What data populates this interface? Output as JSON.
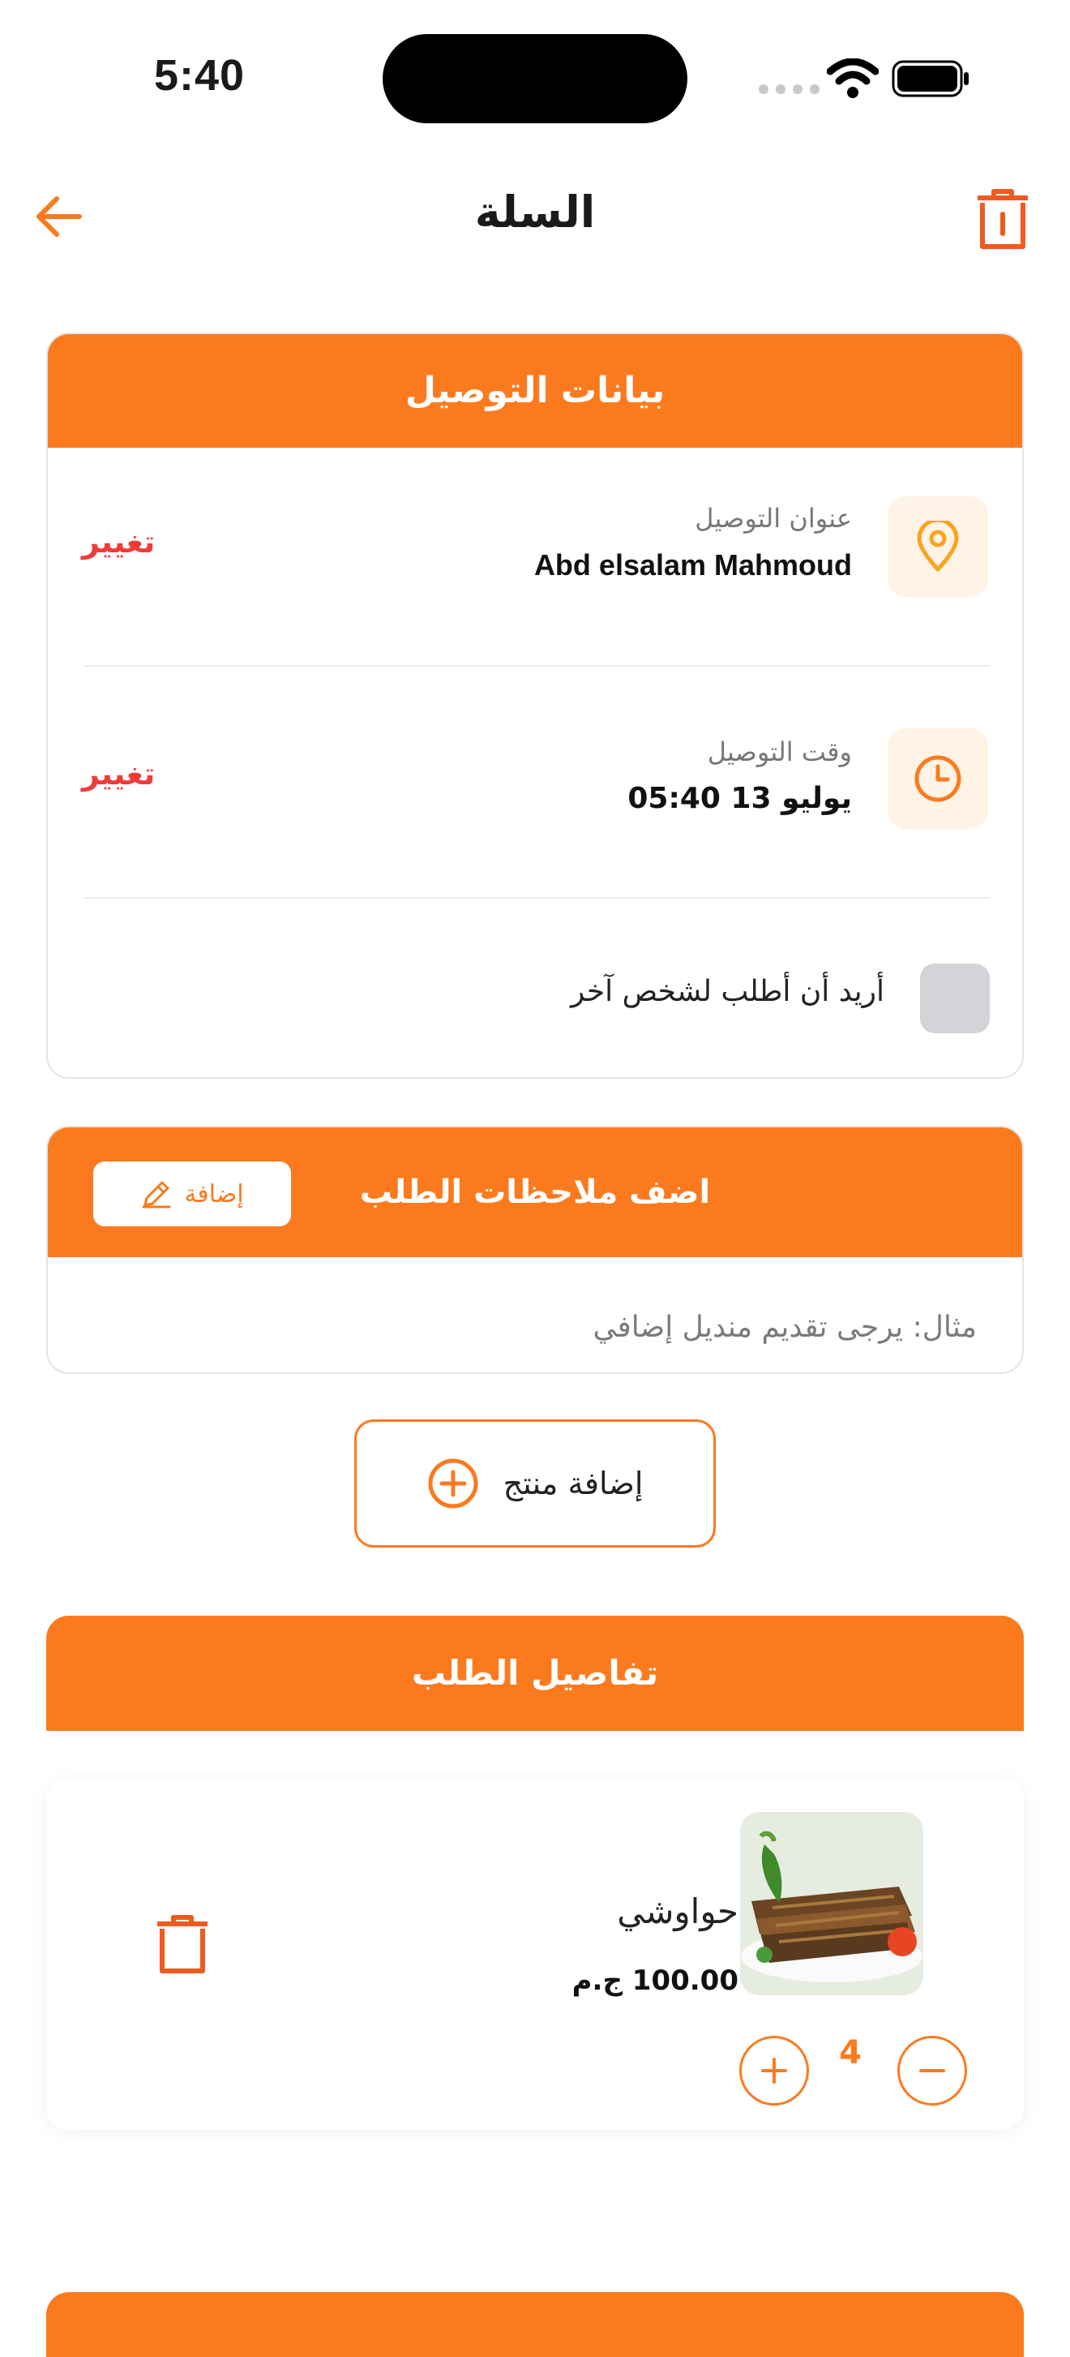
{
  "status_bar": {
    "time": "5:40"
  },
  "header": {
    "title": "السلة"
  },
  "delivery_card": {
    "title": "بيانات التوصيل",
    "address": {
      "label": "عنوان التوصيل",
      "value": "Abd elsalam Mahmoud",
      "change": "تغيير"
    },
    "time": {
      "label": "وقت التوصيل",
      "value": "يوليو 13  05:40",
      "change": "تغيير"
    },
    "other_person_label": "أريد أن أطلب لشخص آخر"
  },
  "notes_card": {
    "title": "اضف ملاحظات الطلب",
    "add_button": "إضافة",
    "placeholder": "مثال: يرجى تقديم منديل إضافي"
  },
  "add_product_label": "إضافة منتج",
  "order_details": {
    "title": "تفاصيل الطلب",
    "items": [
      {
        "name": "حواوشي",
        "price": "100.00 ج.م",
        "quantity": "4"
      }
    ]
  },
  "colors": {
    "accent": "#fc7a1e",
    "danger": "#ef3b3b",
    "tile_bg": "#fff3e6"
  }
}
